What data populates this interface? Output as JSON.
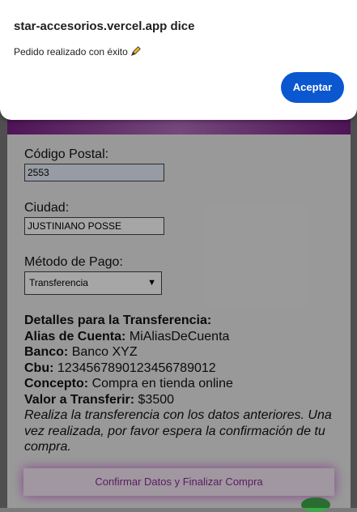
{
  "dialog": {
    "title": "star-accesorios.vercel.app dice",
    "message": "Pedido realizado con éxito",
    "message_icon": "pencil-icon",
    "accept_label": "Aceptar"
  },
  "form": {
    "postal_code": {
      "label": "Código Postal:",
      "value": "2553"
    },
    "city": {
      "label": "Ciudad:",
      "value": "JUSTINIANO POSSE"
    },
    "payment": {
      "label": "Método de Pago:",
      "selected": "Transferencia"
    }
  },
  "transfer": {
    "heading": "Detalles para la Transferencia:",
    "alias_label": "Alias de Cuenta:",
    "alias_value": "MiAliasDeCuenta",
    "bank_label": "Banco:",
    "bank_value": "Banco XYZ",
    "cbu_label": "Cbu:",
    "cbu_value": "1234567890123456789012",
    "concept_label": "Concepto:",
    "concept_value": "Compra en tienda online",
    "amount_label": "Valor a Transferir:",
    "amount_value": "$3500",
    "note": "Realiza la transferencia con los datos anteriores. Una vez realizada, por favor espera la confirmación de tu compra."
  },
  "confirm_label": "Confirmar Datos y Finalizar Compra",
  "colors": {
    "accent": "#0b57d0",
    "brand": "#8a2f95"
  }
}
